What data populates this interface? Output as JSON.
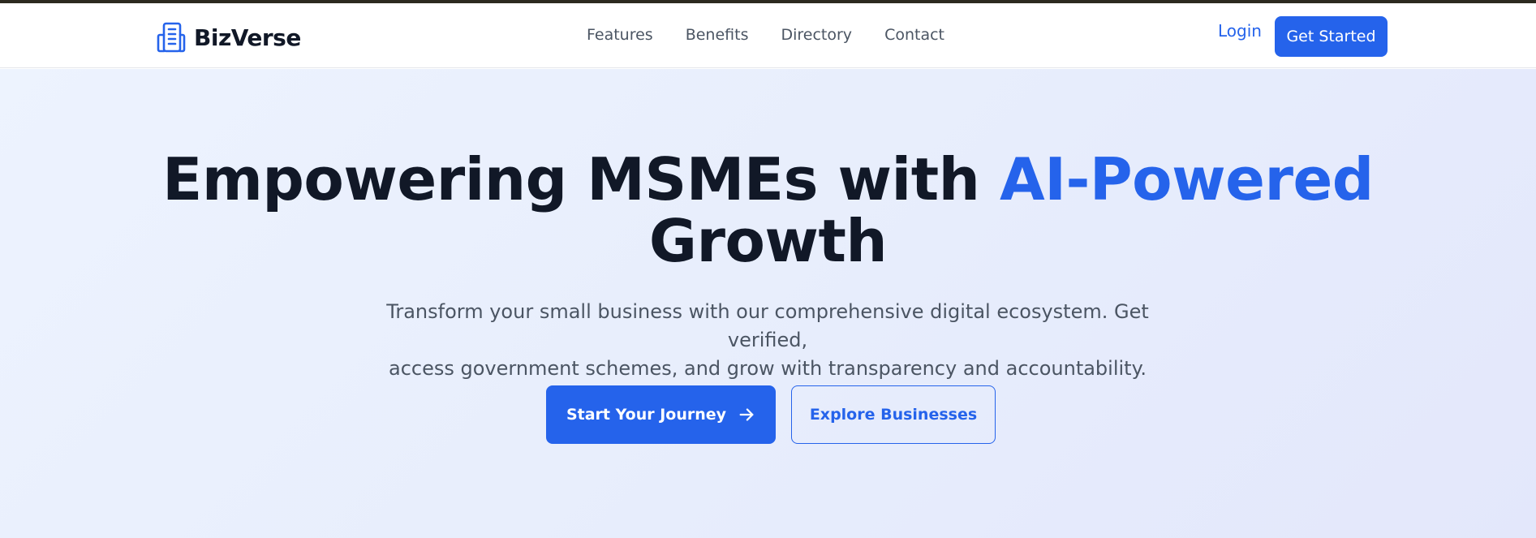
{
  "header": {
    "brand_name": "BizVerse",
    "brand_icon": "building-icon",
    "nav": [
      {
        "label": "Features"
      },
      {
        "label": "Benefits"
      },
      {
        "label": "Directory"
      },
      {
        "label": "Contact"
      }
    ],
    "login_label": "Login",
    "get_started_label": "Get Started"
  },
  "hero": {
    "title_main": "Empowering MSMEs with ",
    "title_accent": "AI-Powered",
    "title_end": "Growth",
    "subtitle_line1": "Transform your small business with our comprehensive digital ecosystem. Get verified,",
    "subtitle_line2": "access government schemes, and grow with transparency and accountability.",
    "primary_cta": "Start Your Journey",
    "primary_cta_icon": "arrow-right-icon",
    "secondary_cta": "Explore Businesses"
  },
  "colors": {
    "accent": "#2563eb",
    "heading": "#111827",
    "body_text": "#4b5563",
    "top_strip": "#2c2a1f"
  }
}
